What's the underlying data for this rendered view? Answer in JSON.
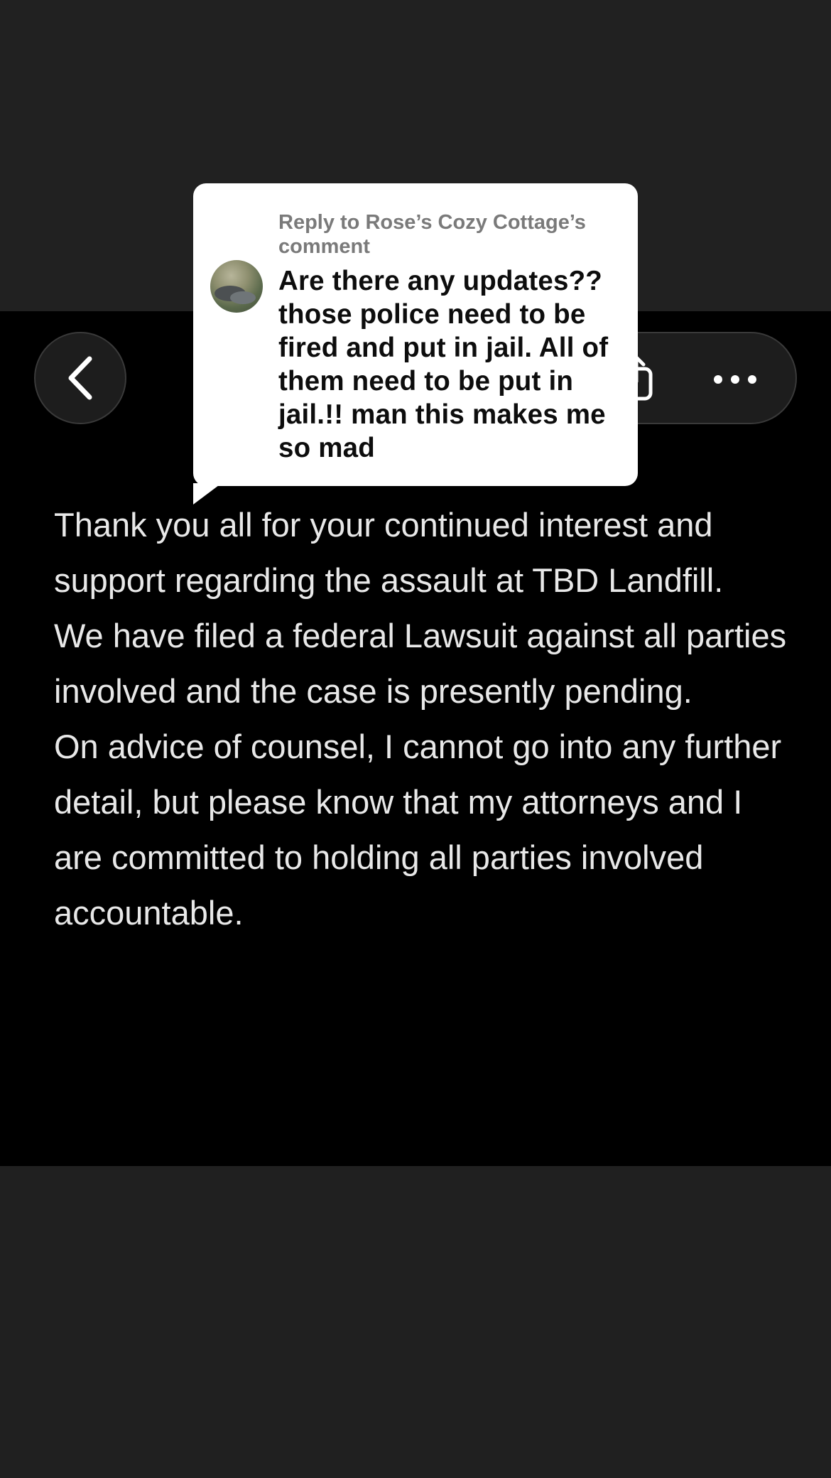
{
  "navigation": {
    "back_icon": "chevron-left-icon",
    "share_icon": "share-icon",
    "more_icon": "more-horizontal-icon"
  },
  "reply_card": {
    "header": "Reply to Rose’s Cozy Cottage’s comment",
    "body": "Are there any updates?? those police need to be fired and put in jail. All of them need to be put in jail.!! man this makes me so mad"
  },
  "post": {
    "paragraphs": [
      "Thank you all for your continued interest and support regarding the assault at TBD Landfill.",
      "We have filed a federal Lawsuit against all parties involved and the case is presently pending.",
      "On advice of counsel, I cannot go into any further detail, but please know that my attorneys and I are committed to holding all parties involved accountable."
    ]
  },
  "colors": {
    "background": "#202020",
    "video_background": "#000000",
    "card_background": "#ffffff",
    "post_text": "#e8e8e8",
    "reply_header_text": "#7a7a7a",
    "reply_body_text": "#0d0d0d"
  }
}
